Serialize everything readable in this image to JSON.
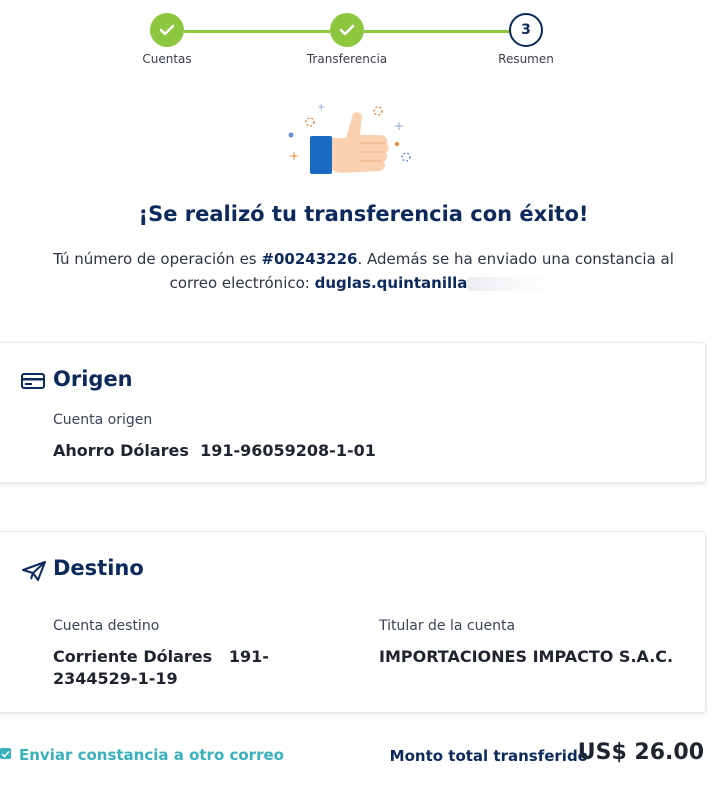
{
  "stepper": {
    "steps": [
      {
        "label": "Cuentas",
        "status": "done"
      },
      {
        "label": "Transferencia",
        "status": "done"
      },
      {
        "label": "Resumen",
        "status": "current",
        "number": "3"
      }
    ]
  },
  "hero": {
    "title": "¡Se realizó tu transferencia con éxito!",
    "line1_prefix": "Tú número de operación es ",
    "operation_number": "#00243226",
    "line1_suffix": ". Además se ha enviado una constancia al",
    "line2_prefix": "correo electrónico: ",
    "email": "duglas.quintanilla"
  },
  "origin": {
    "title": "Origen",
    "account_label": "Cuenta origen",
    "account_value": "Ahorro Dólares  191-96059208-1-01"
  },
  "destination": {
    "title": "Destino",
    "account_label": "Cuenta destino",
    "account_value": "Corriente Dólares   191-2344529-1-19",
    "holder_label": "Titular de la cuenta",
    "holder_value": "IMPORTACIONES IMPACTO S.A.C."
  },
  "footer": {
    "send_link": "Enviar constancia a otro correo",
    "total_label": "Monto total transferido",
    "total_value": "US$ 26.00"
  },
  "colors": {
    "primary": "#0c2a5b",
    "success": "#8dc63f",
    "accent": "#37b1bc"
  }
}
